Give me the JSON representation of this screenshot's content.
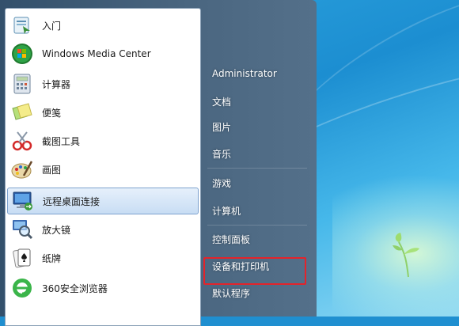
{
  "start_menu": {
    "programs": [
      {
        "label": "入门",
        "icon": "getting-started-icon"
      },
      {
        "label": "Windows Media Center",
        "icon": "windows-media-center-icon"
      },
      {
        "label": "计算器",
        "icon": "calculator-icon"
      },
      {
        "label": "便笺",
        "icon": "sticky-notes-icon"
      },
      {
        "label": "截图工具",
        "icon": "snipping-tool-icon"
      },
      {
        "label": "画图",
        "icon": "paint-icon"
      },
      {
        "label": "远程桌面连接",
        "icon": "remote-desktop-icon",
        "selected": true
      },
      {
        "label": "放大镜",
        "icon": "magnifier-icon"
      },
      {
        "label": "纸牌",
        "icon": "solitaire-icon"
      },
      {
        "label": "360安全浏览器",
        "icon": "360-browser-icon"
      }
    ],
    "right_links": [
      {
        "label": "Administrator"
      },
      {
        "label": "文档"
      },
      {
        "label": "图片"
      },
      {
        "label": "音乐"
      },
      {
        "label": "游戏"
      },
      {
        "label": "计算机"
      },
      {
        "label": "控制面板"
      },
      {
        "label": "设备和打印机",
        "highlighted": true
      },
      {
        "label": "默认程序"
      }
    ]
  },
  "colors": {
    "highlight_box": "#e4232a",
    "selected_bg": "#c8ddf4",
    "right_pane": "#4a6680"
  }
}
